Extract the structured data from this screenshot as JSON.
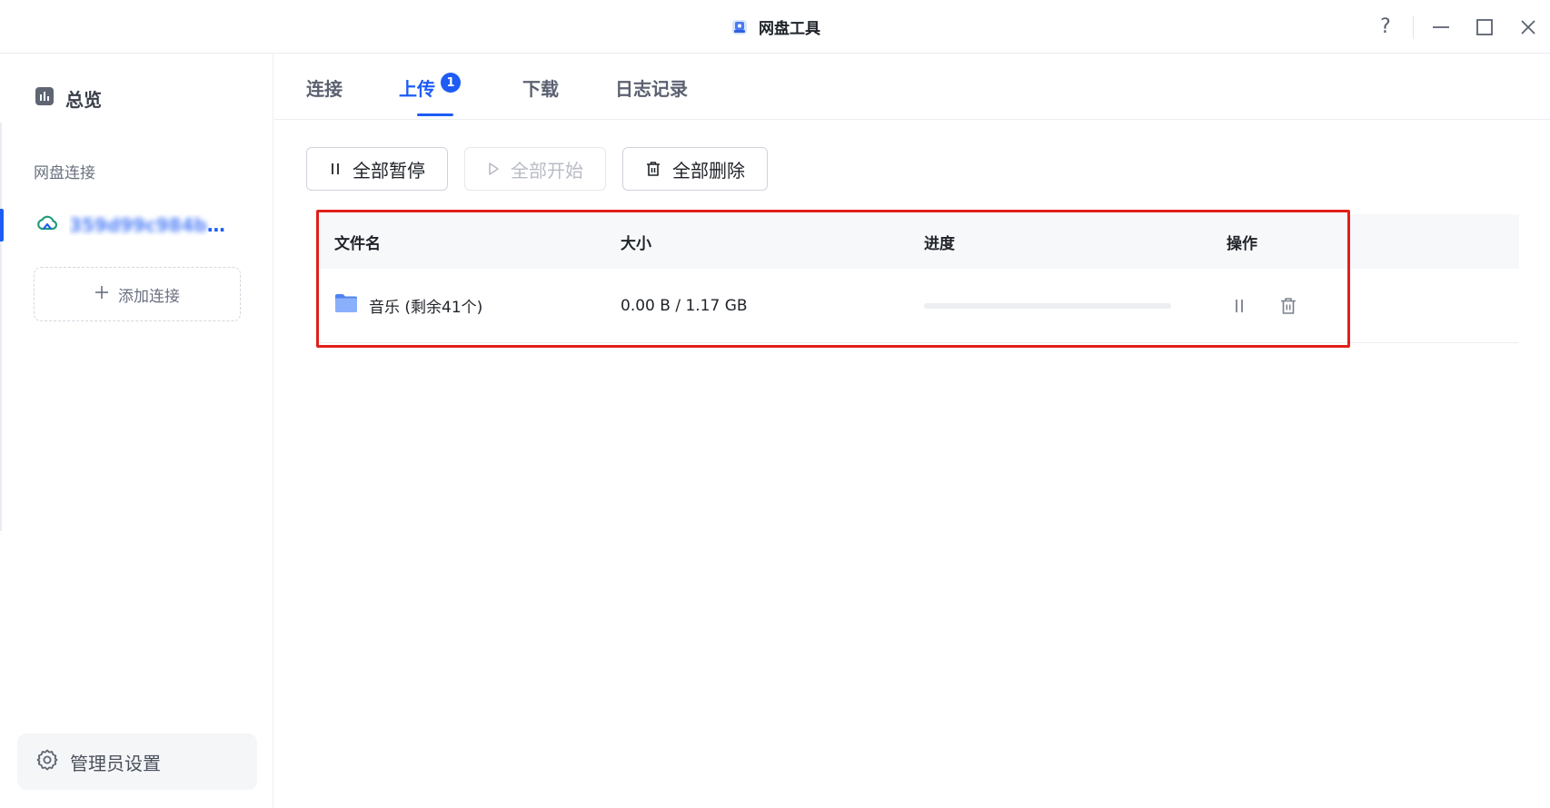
{
  "window": {
    "title": "网盘工具",
    "controls": {
      "help": "?"
    }
  },
  "sidebar": {
    "overview_label": "总览",
    "section_label": "网盘连接",
    "connection": {
      "name_hidden": "359d99c984b0",
      "name_tail": "4..."
    },
    "add_connection_label": "添加连接",
    "admin_settings_label": "管理员设置"
  },
  "tabs": [
    {
      "label": "连接",
      "active": false
    },
    {
      "label": "上传",
      "active": true,
      "badge": "1"
    },
    {
      "label": "下载",
      "active": false
    },
    {
      "label": "日志记录",
      "active": false
    }
  ],
  "toolbar": {
    "pause_all": "全部暂停",
    "start_all": "全部开始",
    "delete_all": "全部删除"
  },
  "table": {
    "headers": {
      "name": "文件名",
      "size": "大小",
      "progress": "进度",
      "actions": "操作"
    },
    "rows": [
      {
        "name": "音乐 (剩余41个)",
        "size": "0.00 B / 1.17 GB",
        "progress": 0
      }
    ]
  },
  "colors": {
    "accent": "#1e5cf5",
    "highlight": "#e0201b",
    "folder": "#5b8cf6"
  },
  "icons": {
    "app": "app-logo-icon",
    "overview": "chart-icon",
    "cloud": "cloud-icon",
    "plus": "plus-icon",
    "gear": "gear-icon",
    "pause": "pause-icon",
    "play": "play-icon",
    "trash": "trash-icon",
    "folder": "folder-icon"
  }
}
